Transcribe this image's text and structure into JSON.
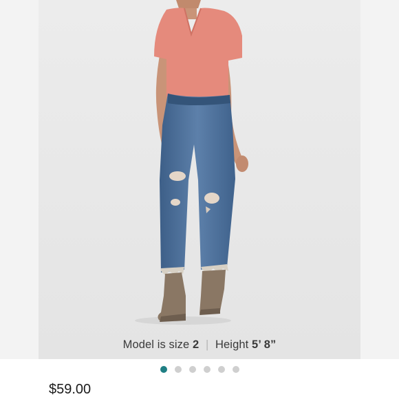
{
  "caption": {
    "prefix": "Model is size",
    "size_value": "2",
    "separator": "|",
    "height_label": "Height",
    "height_value": "5’ 8”"
  },
  "carousel": {
    "total_dots": 6,
    "active_index": 0,
    "active_color": "#1f7f84",
    "inactive_color": "#cfcfcf"
  },
  "listing": {
    "price": "$59.00"
  },
  "image": {
    "description_icon": "product-photo"
  }
}
